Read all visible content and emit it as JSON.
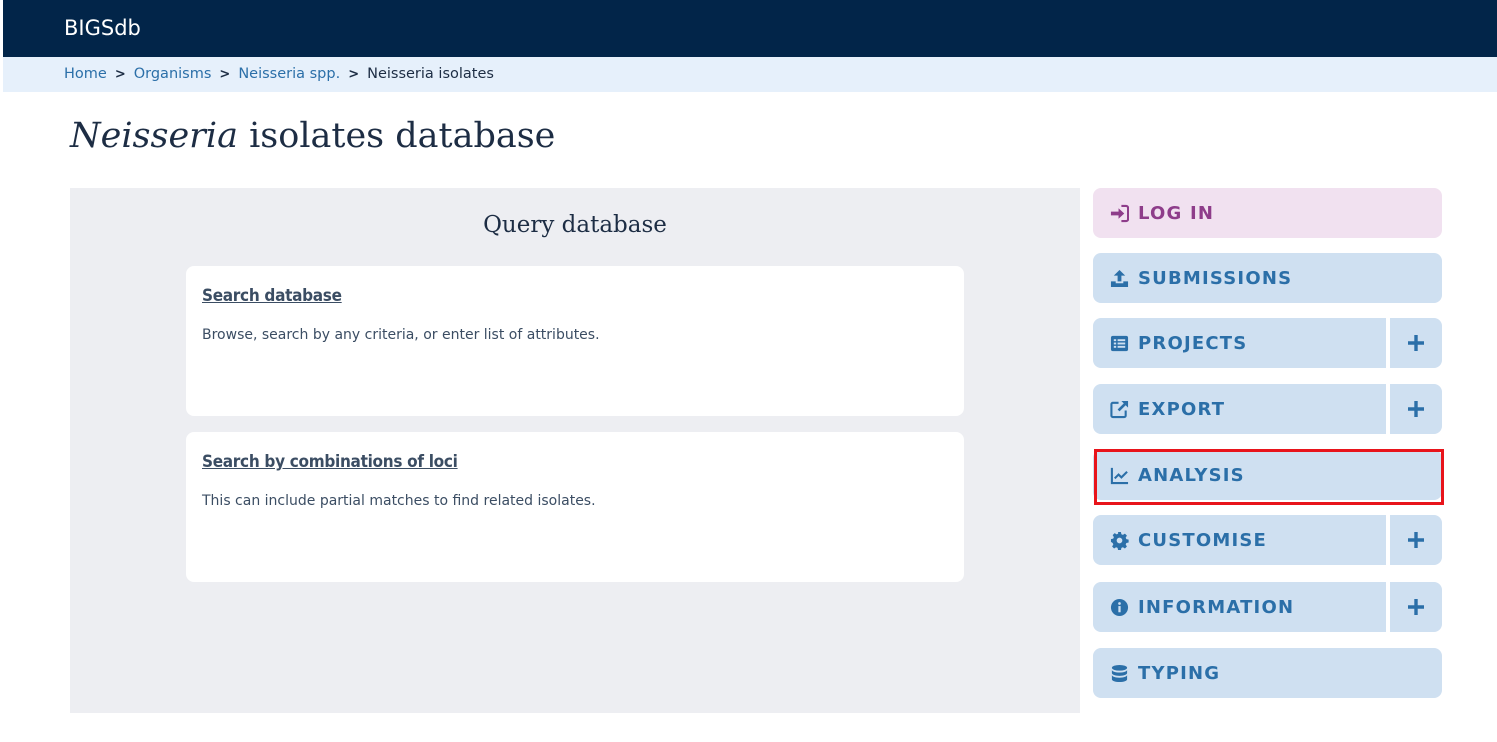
{
  "header": {
    "brand": "BIGSdb"
  },
  "breadcrumb": {
    "items": [
      {
        "label": "Home"
      },
      {
        "label": "Organisms"
      },
      {
        "label": "Neisseria spp."
      }
    ],
    "separator": ">",
    "current": "Neisseria isolates"
  },
  "page": {
    "title_genus": "Neisseria",
    "title_rest": " isolates database"
  },
  "query_panel": {
    "title": "Query database",
    "cards": [
      {
        "link": "Search database",
        "description": "Browse, search by any criteria, or enter list of attributes."
      },
      {
        "link": "Search by combinations of loci",
        "description": "This can include partial matches to find related isolates."
      }
    ]
  },
  "sidebar": {
    "login": {
      "label": "LOG IN",
      "icon": "sign-in-icon"
    },
    "submissions": {
      "label": "SUBMISSIONS",
      "icon": "upload-icon"
    },
    "projects": {
      "label": "PROJECTS",
      "icon": "list-icon",
      "expand": "+"
    },
    "export": {
      "label": "EXPORT",
      "icon": "external-link-icon",
      "expand": "+"
    },
    "analysis": {
      "label": "ANALYSIS",
      "icon": "chart-line-icon"
    },
    "customise": {
      "label": "CUSTOMISE",
      "icon": "cog-icon",
      "expand": "+"
    },
    "information": {
      "label": "INFORMATION",
      "icon": "info-icon",
      "expand": "+"
    },
    "typing": {
      "label": "TYPING",
      "icon": "database-icon"
    }
  },
  "colors": {
    "topbar": "#022549",
    "breadcrumb_bg": "#e6f0fb",
    "panel_bg": "#edeef2",
    "sidebar_btn_bg": "#cfe0f1",
    "sidebar_btn_text": "#2b6fa8",
    "login_bg": "#f1e1f0",
    "login_text": "#8e3d8a",
    "highlight": "#e8141b"
  }
}
